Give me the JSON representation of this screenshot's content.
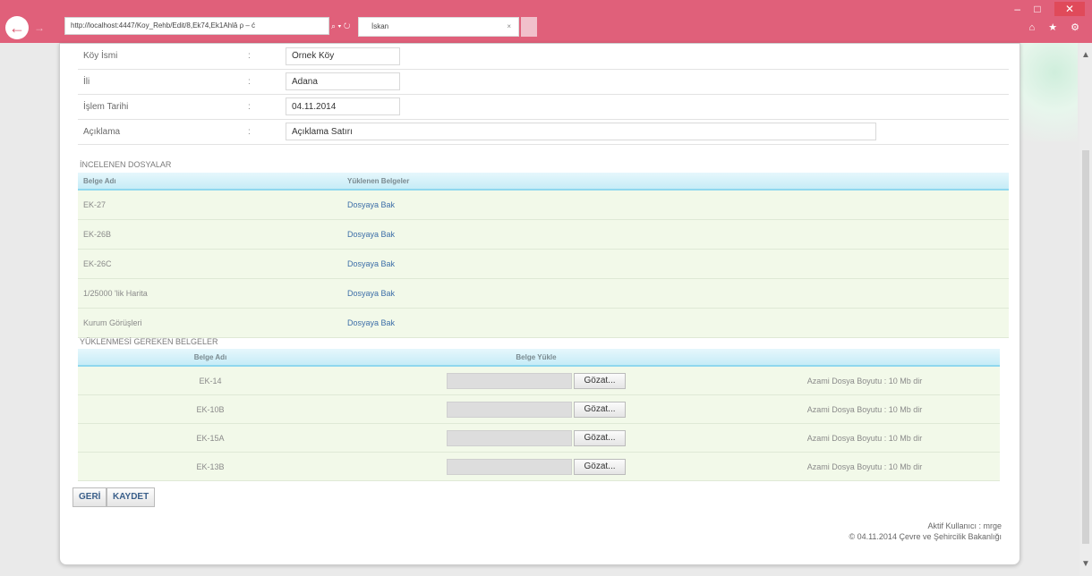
{
  "browser": {
    "url": "http://localhost:4447/Koy_Rehb/Edit/8,Ek74,Ek1Ahlâ ρ – ć",
    "tab_title": "İskan",
    "tab_close": "×",
    "back": "←",
    "forward": "→",
    "win_min": "–",
    "win_max": "□",
    "win_close": "✕",
    "tool_home": "⌂",
    "tool_star": "★",
    "tool_gear": "⚙",
    "addr_icons": "⌕ ▾ ↻"
  },
  "info": [
    {
      "label": "Köy İsmi",
      "value": "Örnek Köy"
    },
    {
      "label": "İli",
      "value": "Adana"
    },
    {
      "label": "İşlem Tarihi",
      "value": "04.11.2014"
    },
    {
      "label": "Açıklama",
      "value": "Açıklama Satırı"
    }
  ],
  "colon": ":",
  "reviewed": {
    "title": "İNCELENEN DOSYALAR",
    "headers": [
      "Belge Adı",
      "Yüklenen Belgeler"
    ],
    "rows": [
      {
        "name": "EK-27",
        "link": "Dosyaya Bak"
      },
      {
        "name": "EK-26B",
        "link": "Dosyaya Bak"
      },
      {
        "name": "EK-26C",
        "link": "Dosyaya Bak"
      },
      {
        "name": "1/25000 'lik Harita",
        "link": "Dosyaya Bak"
      },
      {
        "name": "Kurum Görüşleri",
        "link": "Dosyaya Bak"
      }
    ]
  },
  "required": {
    "title": "YÜKLENMESİ GEREKEN BELGELER",
    "headers": [
      "Belge Adı",
      "Belge Yükle",
      ""
    ],
    "browse_label": "Gözat...",
    "size_note": "Azami Dosya Boyutu : 10 Mb dir",
    "rows": [
      {
        "name": "EK-14"
      },
      {
        "name": "EK-10B"
      },
      {
        "name": "EK-15A"
      },
      {
        "name": "EK-13B"
      }
    ]
  },
  "buttons": {
    "back": "GERİ",
    "save": "KAYDET"
  },
  "footer": {
    "user": "Aktif Kullanıcı : mrge",
    "copyright": "© 04.11.2014 Çevre ve Şehircilik Bakanlığı"
  }
}
